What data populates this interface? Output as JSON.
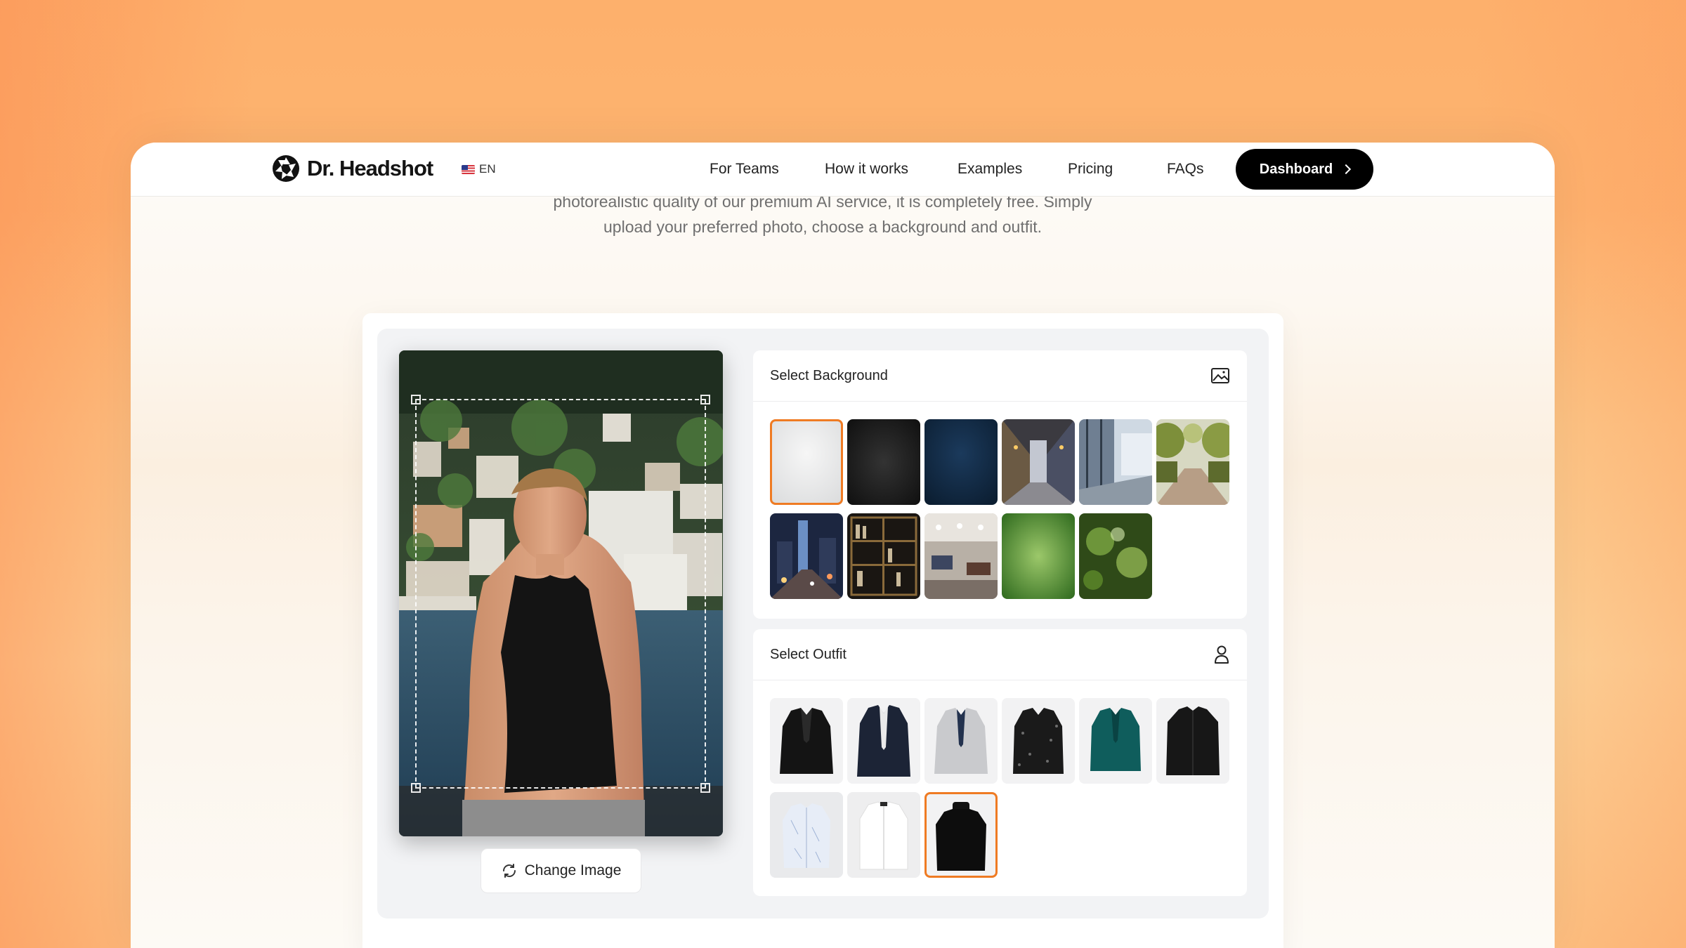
{
  "brand": {
    "name": "Dr. Headshot",
    "language": "EN"
  },
  "nav": {
    "links": [
      "For Teams",
      "How it works",
      "Examples",
      "Pricing",
      "FAQs"
    ],
    "cta": "Dashboard"
  },
  "intro": {
    "line1": "photorealistic quality of our premium AI service, it is completely free. Simply",
    "line2": "upload your preferred photo, choose a background and outfit."
  },
  "editor": {
    "change_image_label": "Change Image"
  },
  "background_panel": {
    "title": "Select Background",
    "icon": "image-icon",
    "options": [
      {
        "kind": "light-gray",
        "selected": true
      },
      {
        "kind": "dark-black",
        "selected": false
      },
      {
        "kind": "navy-texture",
        "selected": false
      },
      {
        "kind": "city-alley",
        "selected": false
      },
      {
        "kind": "office-window",
        "selected": false
      },
      {
        "kind": "park-path",
        "selected": false
      },
      {
        "kind": "city-night",
        "selected": false
      },
      {
        "kind": "bookshelf",
        "selected": false
      },
      {
        "kind": "office-blur",
        "selected": false
      },
      {
        "kind": "green-forest",
        "selected": false
      },
      {
        "kind": "green-bokeh",
        "selected": false
      }
    ]
  },
  "outfit_panel": {
    "title": "Select Outfit",
    "icon": "user-icon",
    "options": [
      {
        "kind": "black-blazer",
        "selected": false
      },
      {
        "kind": "navy-blazer",
        "selected": false
      },
      {
        "kind": "light-gray-blazer",
        "selected": false
      },
      {
        "kind": "patterned-black-blazer",
        "selected": false
      },
      {
        "kind": "teal-blazer",
        "selected": false
      },
      {
        "kind": "black-shirt",
        "selected": false
      },
      {
        "kind": "light-blue-shirt",
        "selected": false
      },
      {
        "kind": "white-shirt",
        "selected": false
      },
      {
        "kind": "black-turtleneck",
        "selected": true
      }
    ]
  },
  "colors": {
    "accent": "#ef7b23",
    "cta_bg": "#000000"
  }
}
